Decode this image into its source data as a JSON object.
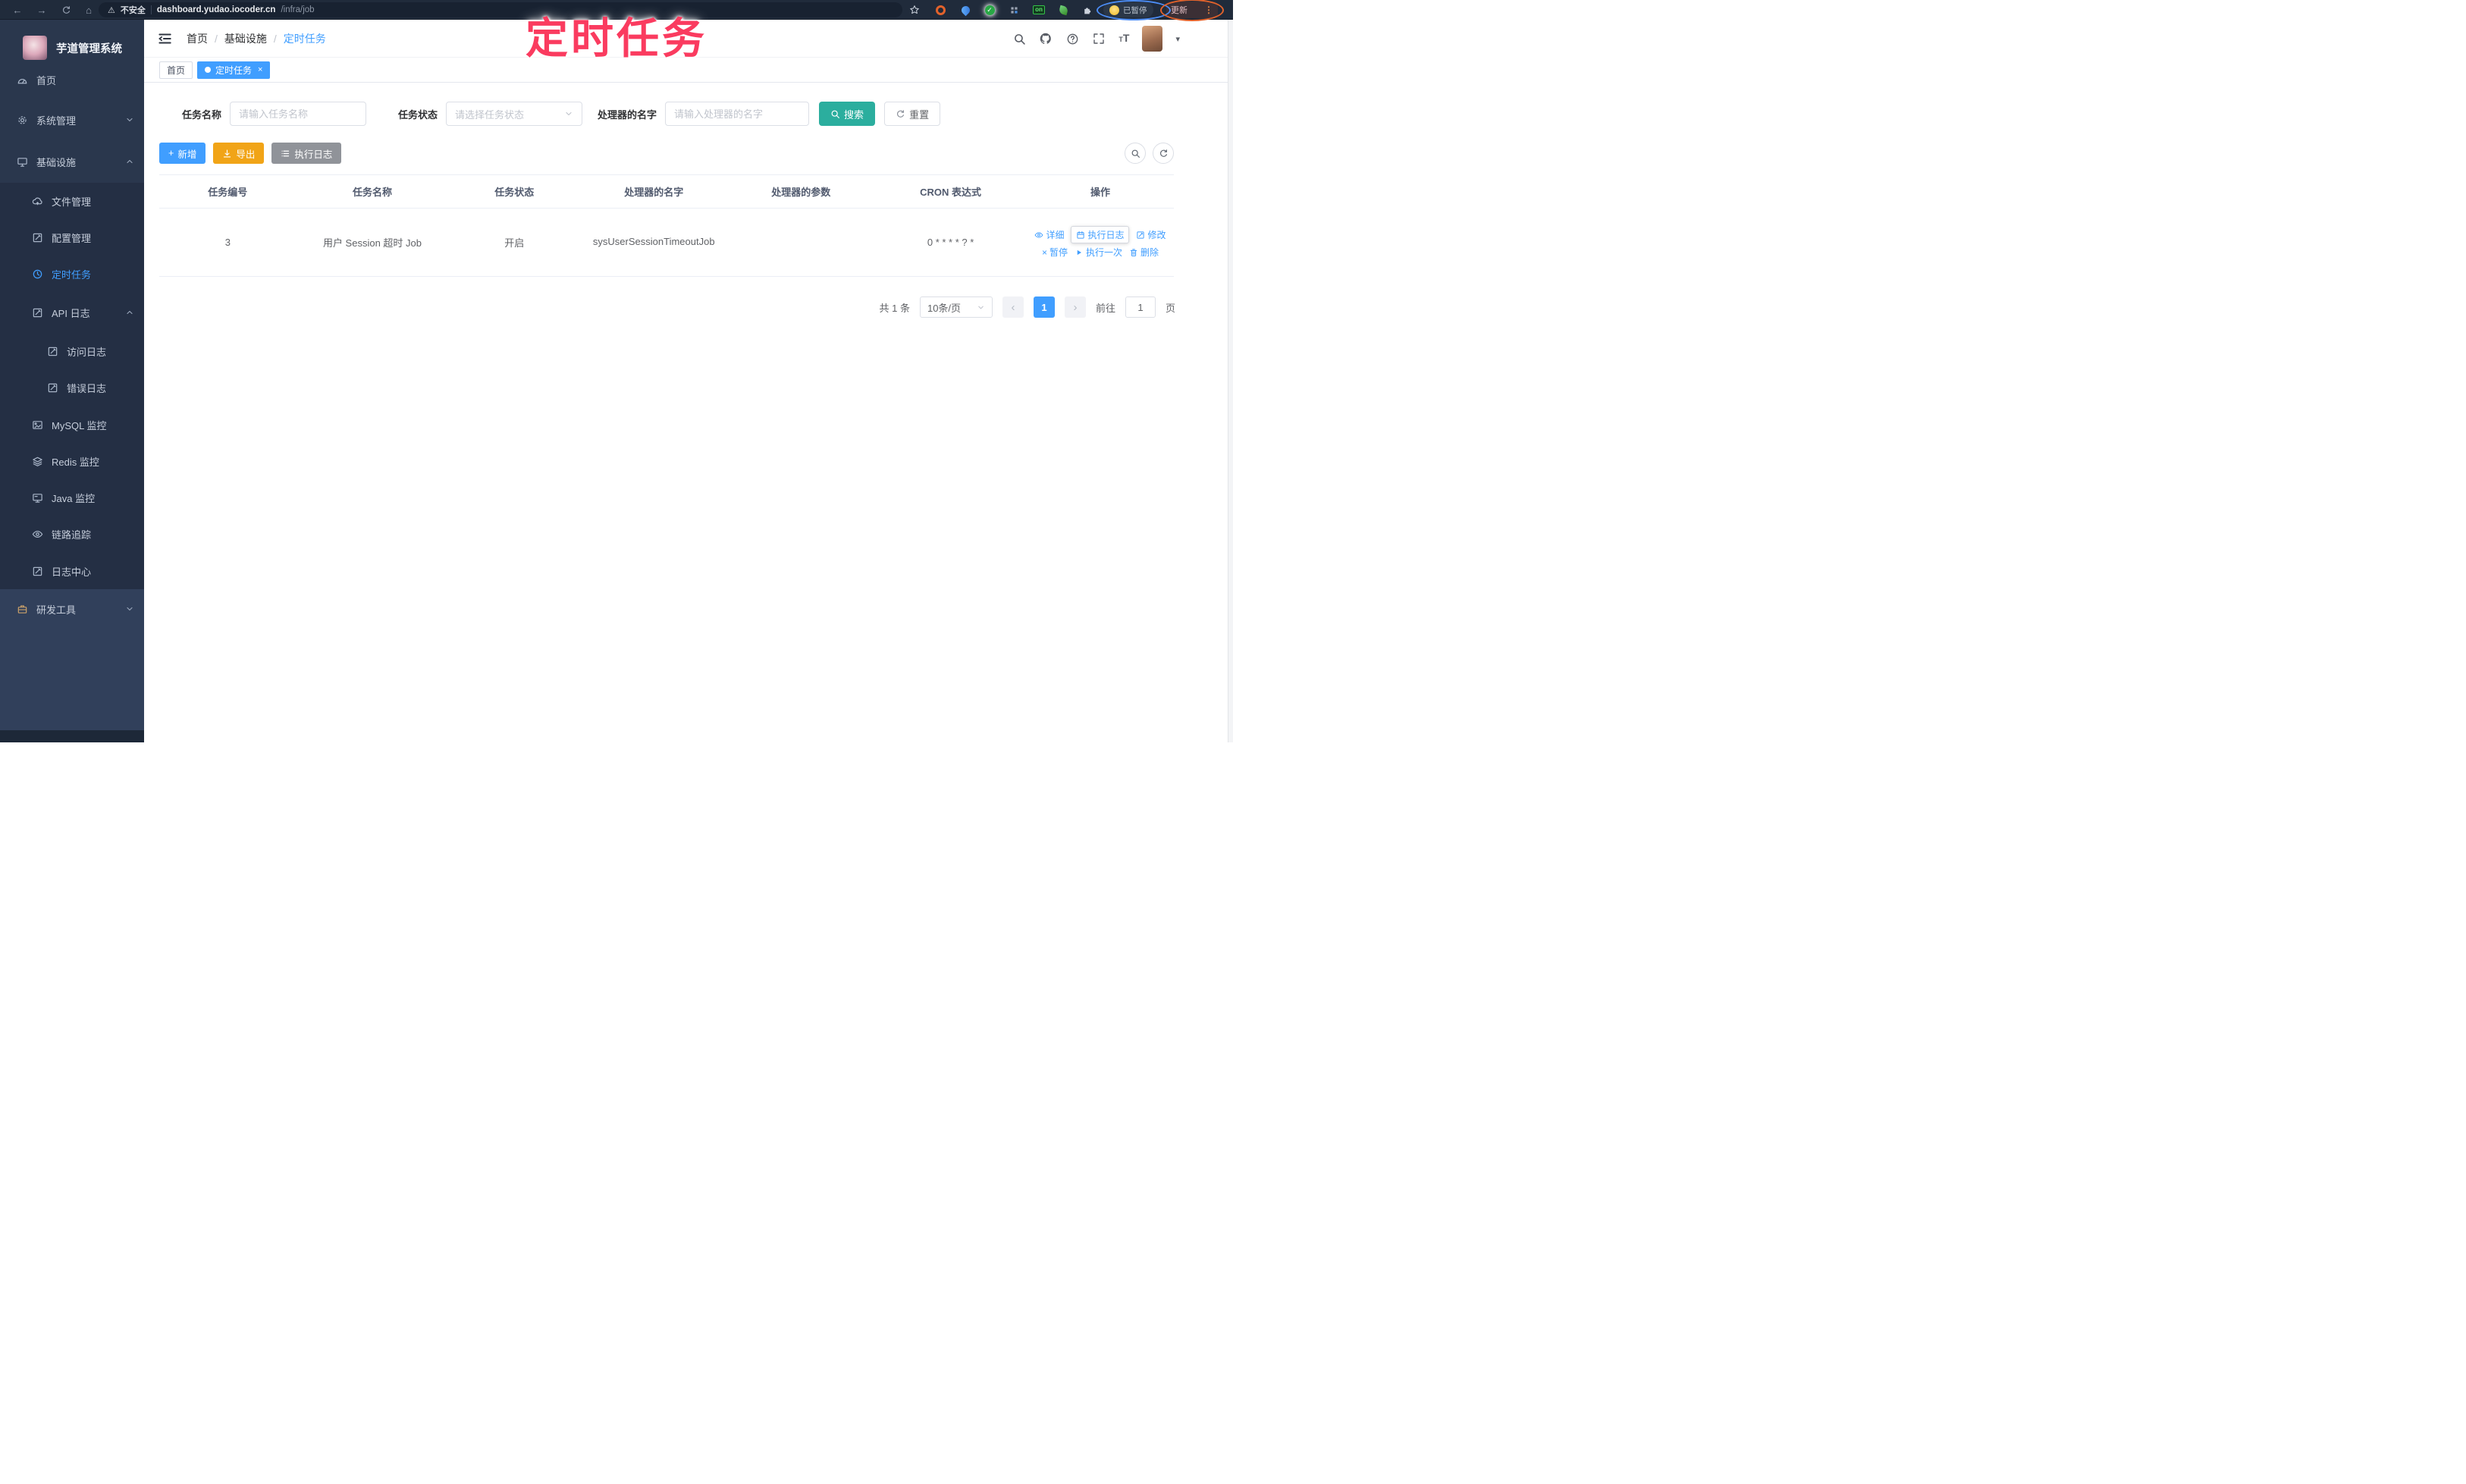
{
  "colors": {
    "accent": "#409EFF",
    "search_button": "#2BAE9E",
    "export_button": "#F1A417",
    "info_button": "#909399",
    "annotation": "#FA3B5F",
    "sidebar_bg": "#2A374D",
    "chrome_bg": "#202B3B"
  },
  "browser": {
    "back_icon": "←",
    "forward_icon": "→",
    "home_icon": "⌂",
    "warning_icon": "⚠",
    "security_label": "不安全",
    "url_domain": "dashboard.yudao.iocoder.cn",
    "url_path": "/infra/job",
    "star_icon": "★",
    "check_icon": "✓",
    "ext_on_badge": "on",
    "paused_label": "已暂停",
    "update_label": "更新",
    "menu_icon": "⋮"
  },
  "annotation": {
    "title": "定时任务"
  },
  "sidebar": {
    "app_title": "芋道管理系统",
    "items": [
      {
        "label": "首页"
      },
      {
        "label": "系统管理"
      },
      {
        "label": "基础设施"
      },
      {
        "label": "文件管理"
      },
      {
        "label": "配置管理"
      },
      {
        "label": "定时任务",
        "active": true
      },
      {
        "label": "API 日志"
      },
      {
        "label": "访问日志"
      },
      {
        "label": "错误日志"
      },
      {
        "label": "MySQL 监控"
      },
      {
        "label": "Redis 监控"
      },
      {
        "label": "Java 监控"
      },
      {
        "label": "链路追踪"
      },
      {
        "label": "日志中心"
      },
      {
        "label": "研发工具"
      }
    ]
  },
  "navbar": {
    "breadcrumb": [
      "首页",
      "基础设施",
      "定时任务"
    ],
    "separator": "/",
    "font_icon_big": "T",
    "font_icon_small": "T",
    "caret_icon": "▾"
  },
  "tags": {
    "items": [
      {
        "label": "首页"
      },
      {
        "label": "定时任务",
        "close_icon": "×"
      }
    ]
  },
  "filters": {
    "name_label": "任务名称",
    "name_placeholder": "请输入任务名称",
    "status_label": "任务状态",
    "status_placeholder": "请选择任务状态",
    "handler_label": "处理器的名字",
    "handler_placeholder": "请输入处理器的名字",
    "search_label": "搜索",
    "reset_label": "重置"
  },
  "toolbar": {
    "add_icon": "+",
    "add_label": "新增",
    "export_label": "导出",
    "runlog_label": "执行日志"
  },
  "table": {
    "headers": [
      "任务编号",
      "任务名称",
      "任务状态",
      "处理器的名字",
      "处理器的参数",
      "CRON 表达式",
      "操作"
    ],
    "rows": [
      {
        "id": "3",
        "name": "用户 Session 超时 Job",
        "status": "开启",
        "handler": "sysUserSessionTimeoutJob",
        "param": "",
        "cron": "0 * * * * ? *"
      }
    ],
    "actions": [
      {
        "label": "详细"
      },
      {
        "label": "执行日志"
      },
      {
        "label": "修改"
      },
      {
        "label": "暂停",
        "icon": "×"
      },
      {
        "label": "执行一次"
      },
      {
        "label": "删除"
      }
    ]
  },
  "pagination": {
    "total": "共 1 条",
    "page_size": "10条/页",
    "prev_icon": "‹",
    "next_icon": "›",
    "current_page": "1",
    "goto_label": "前往",
    "goto_value": "1",
    "page_unit": "页"
  }
}
